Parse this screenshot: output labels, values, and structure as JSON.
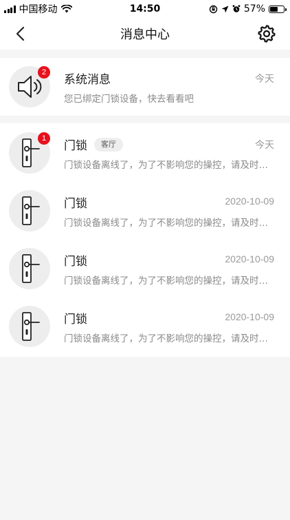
{
  "status_bar": {
    "carrier": "中国移动",
    "time": "14:50",
    "battery": "57%",
    "battery_level": 0.57
  },
  "nav": {
    "title": "消息中心"
  },
  "system": {
    "title": "系统消息",
    "subtitle": "您已绑定门锁设备，快去看看吧",
    "date": "今天",
    "badge": "2",
    "icon": "speaker-icon"
  },
  "messages": [
    {
      "title": "门锁",
      "tag": "客厅",
      "date": "今天",
      "badge": "1",
      "subtitle": "门锁设备离线了，为了不影响您的操控，请及时检查设备",
      "icon": "door-lock-icon"
    },
    {
      "title": "门锁",
      "tag": "",
      "date": "2020-10-09",
      "badge": "",
      "subtitle": "门锁设备离线了，为了不影响您的操控，请及时检查设备",
      "icon": "door-lock-icon"
    },
    {
      "title": "门锁",
      "tag": "",
      "date": "2020-10-09",
      "badge": "",
      "subtitle": "门锁设备离线了，为了不影响您的操控，请及时检查设备",
      "icon": "door-lock-icon"
    },
    {
      "title": "门锁",
      "tag": "",
      "date": "2020-10-09",
      "badge": "",
      "subtitle": "门锁设备离线了，为了不影响您的操控，请及时检查设备",
      "icon": "door-lock-icon"
    }
  ],
  "colors": {
    "badge": "#e8101c",
    "background": "#f5f5f5",
    "card": "#ffffff"
  }
}
